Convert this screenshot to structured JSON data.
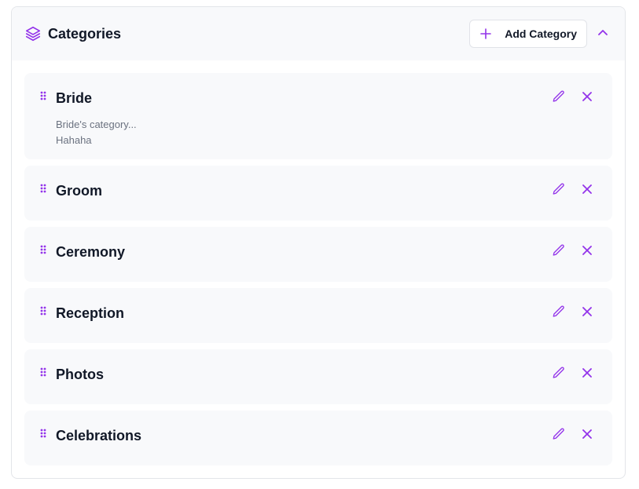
{
  "colors": {
    "accent": "#9333ea",
    "header_bg": "#f8f9fb",
    "item_bg": "#f8f9fb",
    "border": "#e3e5e9"
  },
  "header": {
    "icon": "layers-icon",
    "title": "Categories",
    "add_button_label": "Add Category",
    "add_button_icon": "plus-icon",
    "collapse_icon": "chevron-up-icon"
  },
  "categories": [
    {
      "name": "Bride",
      "description_lines": [
        "Bride's category...",
        "Hahaha"
      ]
    },
    {
      "name": "Groom"
    },
    {
      "name": "Ceremony"
    },
    {
      "name": "Reception"
    },
    {
      "name": "Photos"
    },
    {
      "name": "Celebrations"
    }
  ],
  "item_icons": {
    "drag": "drag-handle-icon",
    "edit": "pencil-icon",
    "delete": "close-icon"
  }
}
